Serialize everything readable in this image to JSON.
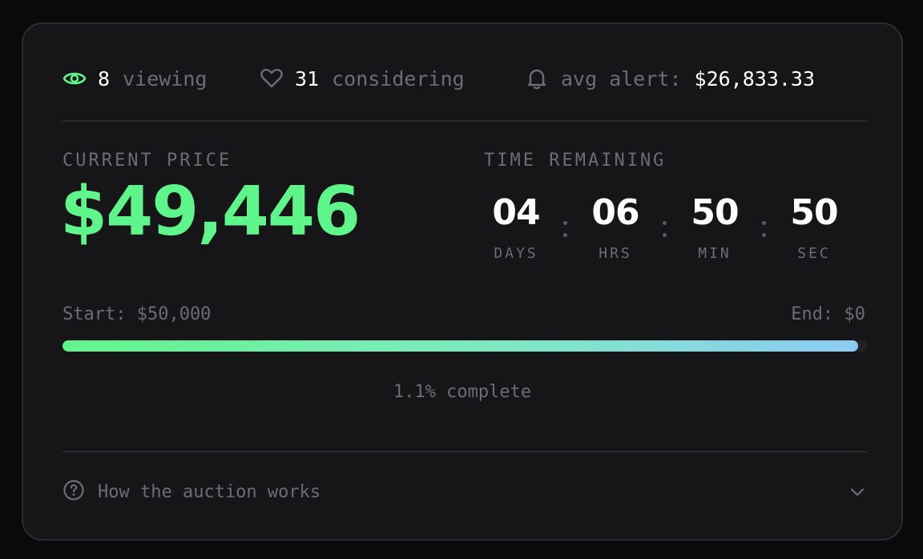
{
  "stats": {
    "viewing_count": "8",
    "viewing_label": "viewing",
    "considering_count": "31",
    "considering_label": "considering",
    "alert_label": "avg alert:",
    "alert_value": "$26,833.33"
  },
  "price": {
    "label": "CURRENT PRICE",
    "value": "$49,446"
  },
  "countdown": {
    "label": "TIME REMAINING",
    "units": [
      {
        "value": "04",
        "unit": "DAYS"
      },
      {
        "value": "06",
        "unit": "HRS"
      },
      {
        "value": "50",
        "unit": "MIN"
      },
      {
        "value": "50",
        "unit": "SEC"
      }
    ]
  },
  "progress": {
    "start_label": "Start: $50,000",
    "end_label": "End: $0",
    "fill_fraction": 0.989,
    "complete_text": "1.1% complete"
  },
  "faq": {
    "label": "How the auction works"
  },
  "colors": {
    "accent": "#5ef58a",
    "gradient_end": "#8ccbf4",
    "card_bg": "#161619",
    "muted_text": "#6c6c76"
  },
  "icons": {
    "viewing": "eye-icon",
    "considering": "heart-icon",
    "alert": "bell-icon",
    "faq": "question-circle-icon",
    "expand": "chevron-down-icon"
  }
}
